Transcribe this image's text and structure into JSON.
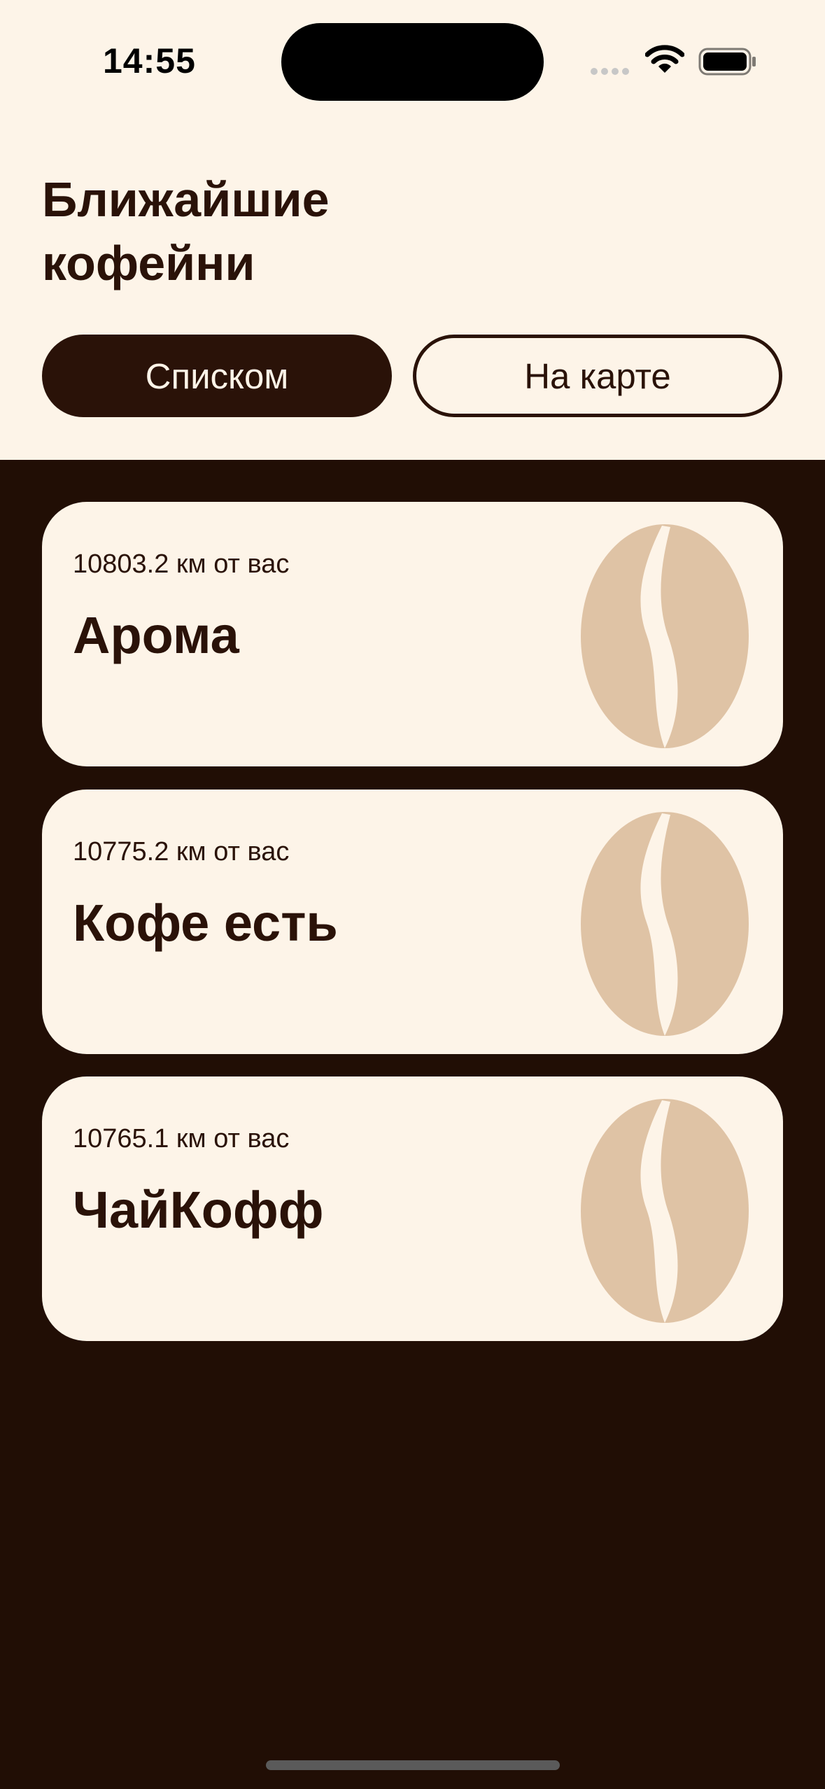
{
  "status_bar": {
    "time": "14:55"
  },
  "header": {
    "title": "Ближайшие\nкофейни"
  },
  "segments": {
    "list_label": "Списком",
    "map_label": "На карте"
  },
  "cafes": [
    {
      "distance": "10803.2 км от вас",
      "name": "Арома"
    },
    {
      "distance": "10775.2 км от вас",
      "name": "Кофе есть"
    },
    {
      "distance": "10765.1 км от вас",
      "name": "ЧайКофф"
    }
  ],
  "colors": {
    "background_dark": "#210e05",
    "background_light": "#fdf4e8",
    "text_dark": "#2a1208",
    "bean": "#dfc3a5"
  },
  "icons": {
    "card_icon": "coffee-bean-icon"
  }
}
